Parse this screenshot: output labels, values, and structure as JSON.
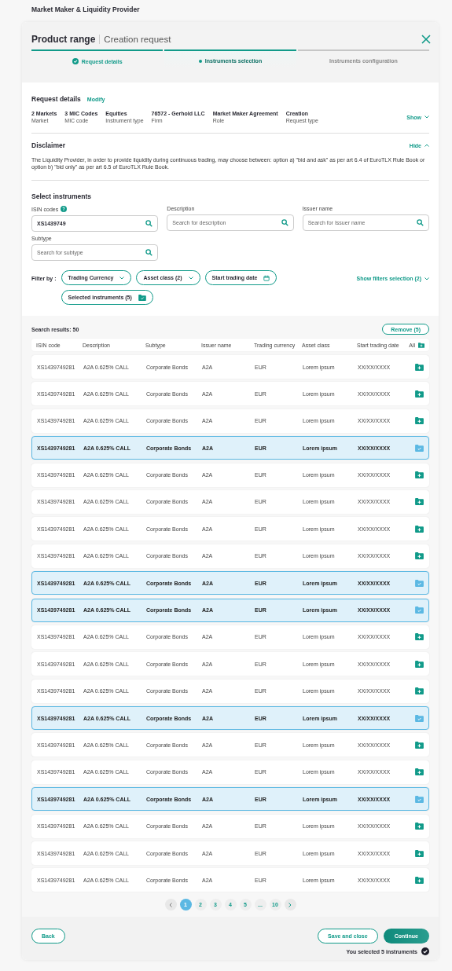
{
  "page_title": "Market Maker & Liquidity Provider",
  "header": {
    "title": "Product range",
    "subtitle": "Creation request"
  },
  "steps": [
    {
      "label": "Request details",
      "selected": false
    },
    {
      "label": "Instruments selection",
      "selected": true
    },
    {
      "label": "Instruments configuration",
      "selected": false
    }
  ],
  "request_details": {
    "title": "Request details",
    "modify": "Modify",
    "toggle": "Show",
    "items": [
      {
        "value": "2 Markets",
        "label": "Market"
      },
      {
        "value": "3 MIC Codes",
        "label": "MIC code"
      },
      {
        "value": "Equities",
        "label": "Instrument type"
      },
      {
        "value": "76572 - Gerhold LLC",
        "label": "Firm"
      },
      {
        "value": "Market Maker Agreement",
        "label": "Role"
      },
      {
        "value": "Creation",
        "label": "Request type"
      }
    ]
  },
  "disclaimer": {
    "title": "Disclaimer",
    "toggle": "Hide",
    "expanded": true,
    "text": "The Liquidity Provider, in order to provide liquidity during continuous trading, may choose between: option a) \"bid and ask\" as per art 6.4 of EuroTLX Rule Book or  option b) \"bid only\" as per art 6.5 of EuroTLX Rule Book."
  },
  "select_instruments": {
    "title": "Select instruments",
    "fields": [
      {
        "label": "ISIN codes",
        "help": true,
        "value": "XS1439749"
      },
      {
        "label": "Description",
        "placeholder": "Search for description"
      },
      {
        "label": "Issuer name",
        "placeholder": "Search for Issuer name"
      },
      {
        "label": "Subtype",
        "placeholder": "Search for subtype"
      }
    ],
    "filter_label": "Filter by :",
    "filters": [
      {
        "label": "Trading Currency",
        "kind": "dropdown"
      },
      {
        "label": "Asset class (2)",
        "kind": "dropdown"
      },
      {
        "label": "Start trading date",
        "kind": "date"
      },
      {
        "label": "Selected instruments (5)",
        "kind": "folder"
      }
    ],
    "show_filters": "Show filters selection (2)"
  },
  "results": {
    "count_label": "Search results: 50",
    "remove": "Remove (5)",
    "columns": [
      "ISIN code",
      "Description",
      "Subtype",
      "Issuer name",
      "Trading currency",
      "Asset class",
      "Start trading date",
      "All"
    ],
    "rows": [
      {
        "cells": [
          "XS1439749281",
          "A2A 0.625% CALL",
          "Corporate Bonds",
          "A2A",
          "EUR",
          "Lorem ipsum",
          "XX/XX/XXXX"
        ],
        "selected": false
      },
      {
        "cells": [
          "XS1439749281",
          "A2A 0.625% CALL",
          "Corporate Bonds",
          "A2A",
          "EUR",
          "Lorem ipsum",
          "XX/XX/XXXX"
        ],
        "selected": false
      },
      {
        "cells": [
          "XS1439749281",
          "A2A 0.625% CALL",
          "Corporate Bonds",
          "A2A",
          "EUR",
          "Lorem ipsum",
          "XX/XX/XXXX"
        ],
        "selected": false
      },
      {
        "cells": [
          "XS1439749281",
          "A2A 0.625% CALL",
          "Corporate Bonds",
          "A2A",
          "EUR",
          "Lorem ipsum",
          "XX/XX/XXXX"
        ],
        "selected": true
      },
      {
        "cells": [
          "XS1439749281",
          "A2A 0.625% CALL",
          "Corporate Bonds",
          "A2A",
          "EUR",
          "Lorem ipsum",
          "XX/XX/XXXX"
        ],
        "selected": false
      },
      {
        "cells": [
          "XS1439749281",
          "A2A 0.625% CALL",
          "Corporate Bonds",
          "A2A",
          "EUR",
          "Lorem ipsum",
          "XX/XX/XXXX"
        ],
        "selected": false
      },
      {
        "cells": [
          "XS1439749281",
          "A2A 0.625% CALL",
          "Corporate Bonds",
          "A2A",
          "EUR",
          "Lorem ipsum",
          "XX/XX/XXXX"
        ],
        "selected": false
      },
      {
        "cells": [
          "XS1439749281",
          "A2A 0.625% CALL",
          "Corporate Bonds",
          "A2A",
          "EUR",
          "Lorem ipsum",
          "XX/XX/XXXX"
        ],
        "selected": false
      },
      {
        "cells": [
          "XS1439749281",
          "A2A 0.625% CALL",
          "Corporate Bonds",
          "A2A",
          "EUR",
          "Lorem ipsum",
          "XX/XX/XXXX"
        ],
        "selected": true
      },
      {
        "cells": [
          "XS1439749281",
          "A2A 0.625% CALL",
          "Corporate Bonds",
          "A2A",
          "EUR",
          "Lorem ipsum",
          "XX/XX/XXXX"
        ],
        "selected": true
      },
      {
        "cells": [
          "XS1439749281",
          "A2A 0.625% CALL",
          "Corporate Bonds",
          "A2A",
          "EUR",
          "Lorem ipsum",
          "XX/XX/XXXX"
        ],
        "selected": false
      },
      {
        "cells": [
          "XS1439749281",
          "A2A 0.625% CALL",
          "Corporate Bonds",
          "A2A",
          "EUR",
          "Lorem ipsum",
          "XX/XX/XXXX"
        ],
        "selected": false
      },
      {
        "cells": [
          "XS1439749281",
          "A2A 0.625% CALL",
          "Corporate Bonds",
          "A2A",
          "EUR",
          "Lorem ipsum",
          "XX/XX/XXXX"
        ],
        "selected": false
      },
      {
        "cells": [
          "XS1439749281",
          "A2A 0.625% CALL",
          "Corporate Bonds",
          "A2A",
          "EUR",
          "Lorem ipsum",
          "XX/XX/XXXX"
        ],
        "selected": true
      },
      {
        "cells": [
          "XS1439749281",
          "A2A 0.625% CALL",
          "Corporate Bonds",
          "A2A",
          "EUR",
          "Lorem ipsum",
          "XX/XX/XXXX"
        ],
        "selected": false
      },
      {
        "cells": [
          "XS1439749281",
          "A2A 0.625% CALL",
          "Corporate Bonds",
          "A2A",
          "EUR",
          "Lorem ipsum",
          "XX/XX/XXXX"
        ],
        "selected": false
      },
      {
        "cells": [
          "XS1439749281",
          "A2A 0.625% CALL",
          "Corporate Bonds",
          "A2A",
          "EUR",
          "Lorem ipsum",
          "XX/XX/XXXX"
        ],
        "selected": true
      },
      {
        "cells": [
          "XS1439749281",
          "A2A 0.625% CALL",
          "Corporate Bonds",
          "A2A",
          "EUR",
          "Lorem ipsum",
          "XX/XX/XXXX"
        ],
        "selected": false
      },
      {
        "cells": [
          "XS1439749281",
          "A2A 0.625% CALL",
          "Corporate Bonds",
          "A2A",
          "EUR",
          "Lorem ipsum",
          "XX/XX/XXXX"
        ],
        "selected": false
      },
      {
        "cells": [
          "XS1439749281",
          "A2A 0.625% CALL",
          "Corporate Bonds",
          "A2A",
          "EUR",
          "Lorem ipsum",
          "XX/XX/XXXX"
        ],
        "selected": false
      }
    ]
  },
  "pagination": {
    "pages": [
      {
        "label": "1",
        "selected": true
      },
      {
        "label": "2",
        "selected": false
      },
      {
        "label": "3",
        "selected": false
      },
      {
        "label": "4",
        "selected": false
      },
      {
        "label": "5",
        "selected": false
      },
      {
        "label": "...",
        "selected": false
      },
      {
        "label": "10",
        "selected": false
      }
    ]
  },
  "footer": {
    "back": "Back",
    "save": "Save and close",
    "continue": "Continue",
    "status": "You selected 5 instruments"
  }
}
